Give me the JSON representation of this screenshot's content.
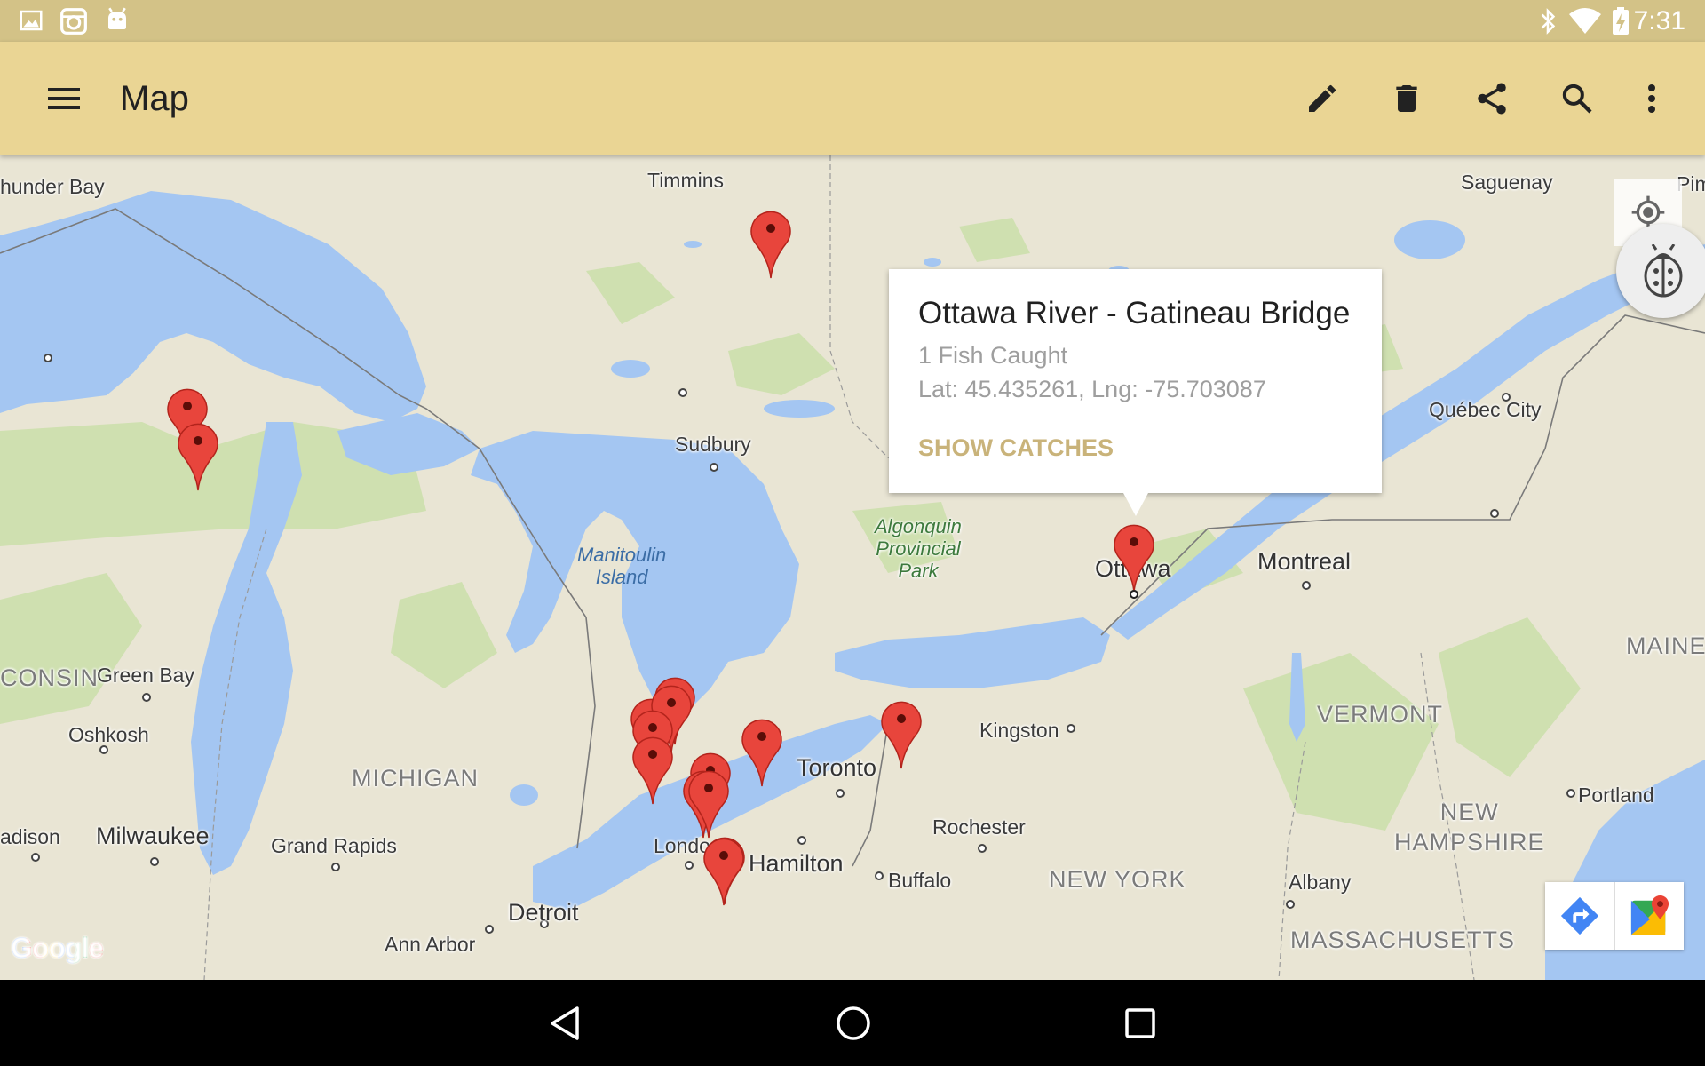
{
  "status_bar": {
    "time": "7:31",
    "left_icons": [
      "gallery-icon",
      "instagram-icon",
      "android-icon"
    ],
    "right_icons": [
      "bluetooth-icon",
      "wifi-icon",
      "battery-charging-icon"
    ],
    "background": "#d3c287"
  },
  "app_bar": {
    "title": "Map",
    "actions": [
      "edit-icon",
      "delete-icon",
      "share-icon",
      "search-icon",
      "more-vert-icon"
    ],
    "background": "#ead594"
  },
  "map": {
    "labels": {
      "thunder_bay": "hunder Bay",
      "timmins": "Timmins",
      "saguenay": "Saguenay",
      "pim": "Pim",
      "sudbury": "Sudbury",
      "quebec_city": "Québec City",
      "manitoulin": "Manitoulin\nIsland",
      "algonquin": "Algonquin\nProvincial\nPark",
      "ottawa": "Ottawa",
      "montreal": "Montreal",
      "consin": "CONSIN",
      "green_bay": "Green Bay",
      "maine": "MAINE",
      "oshkosh": "Oshkosh",
      "kingston": "Kingston",
      "vermont": "VERMONT",
      "michigan": "MICHIGAN",
      "toronto": "Toronto",
      "portland": "Portland",
      "new_hampshire": "NEW\nHAMPSHIRE",
      "madison": "adison",
      "milwaukee": "Milwaukee",
      "grand_rapids": "Grand Rapids",
      "london": "Londo",
      "hamilton": "Hamilton",
      "rochester": "Rochester",
      "buffalo": "Buffalo",
      "new_york": "NEW YORK",
      "albany": "Albany",
      "detroit": "Detroit",
      "ann_arbor": "Ann Arbor",
      "massachusetts": "MASSACHUSETTS"
    },
    "info_window": {
      "title": "Ottawa River - Gatineau Bridge",
      "subtitle": "1 Fish Caught",
      "latlng": "Lat: 45.435261, Lng: -75.703087",
      "action": "SHOW CATCHES",
      "action_color": "#c9b37a"
    },
    "marker_color": "#e8453c",
    "marker_count": 16,
    "logo": "Google",
    "controls": [
      "my-location-icon",
      "bug-icon",
      "directions-icon",
      "google-maps-icon"
    ]
  },
  "nav_bar": {
    "buttons": [
      "back-icon",
      "home-icon",
      "recents-icon"
    ]
  }
}
